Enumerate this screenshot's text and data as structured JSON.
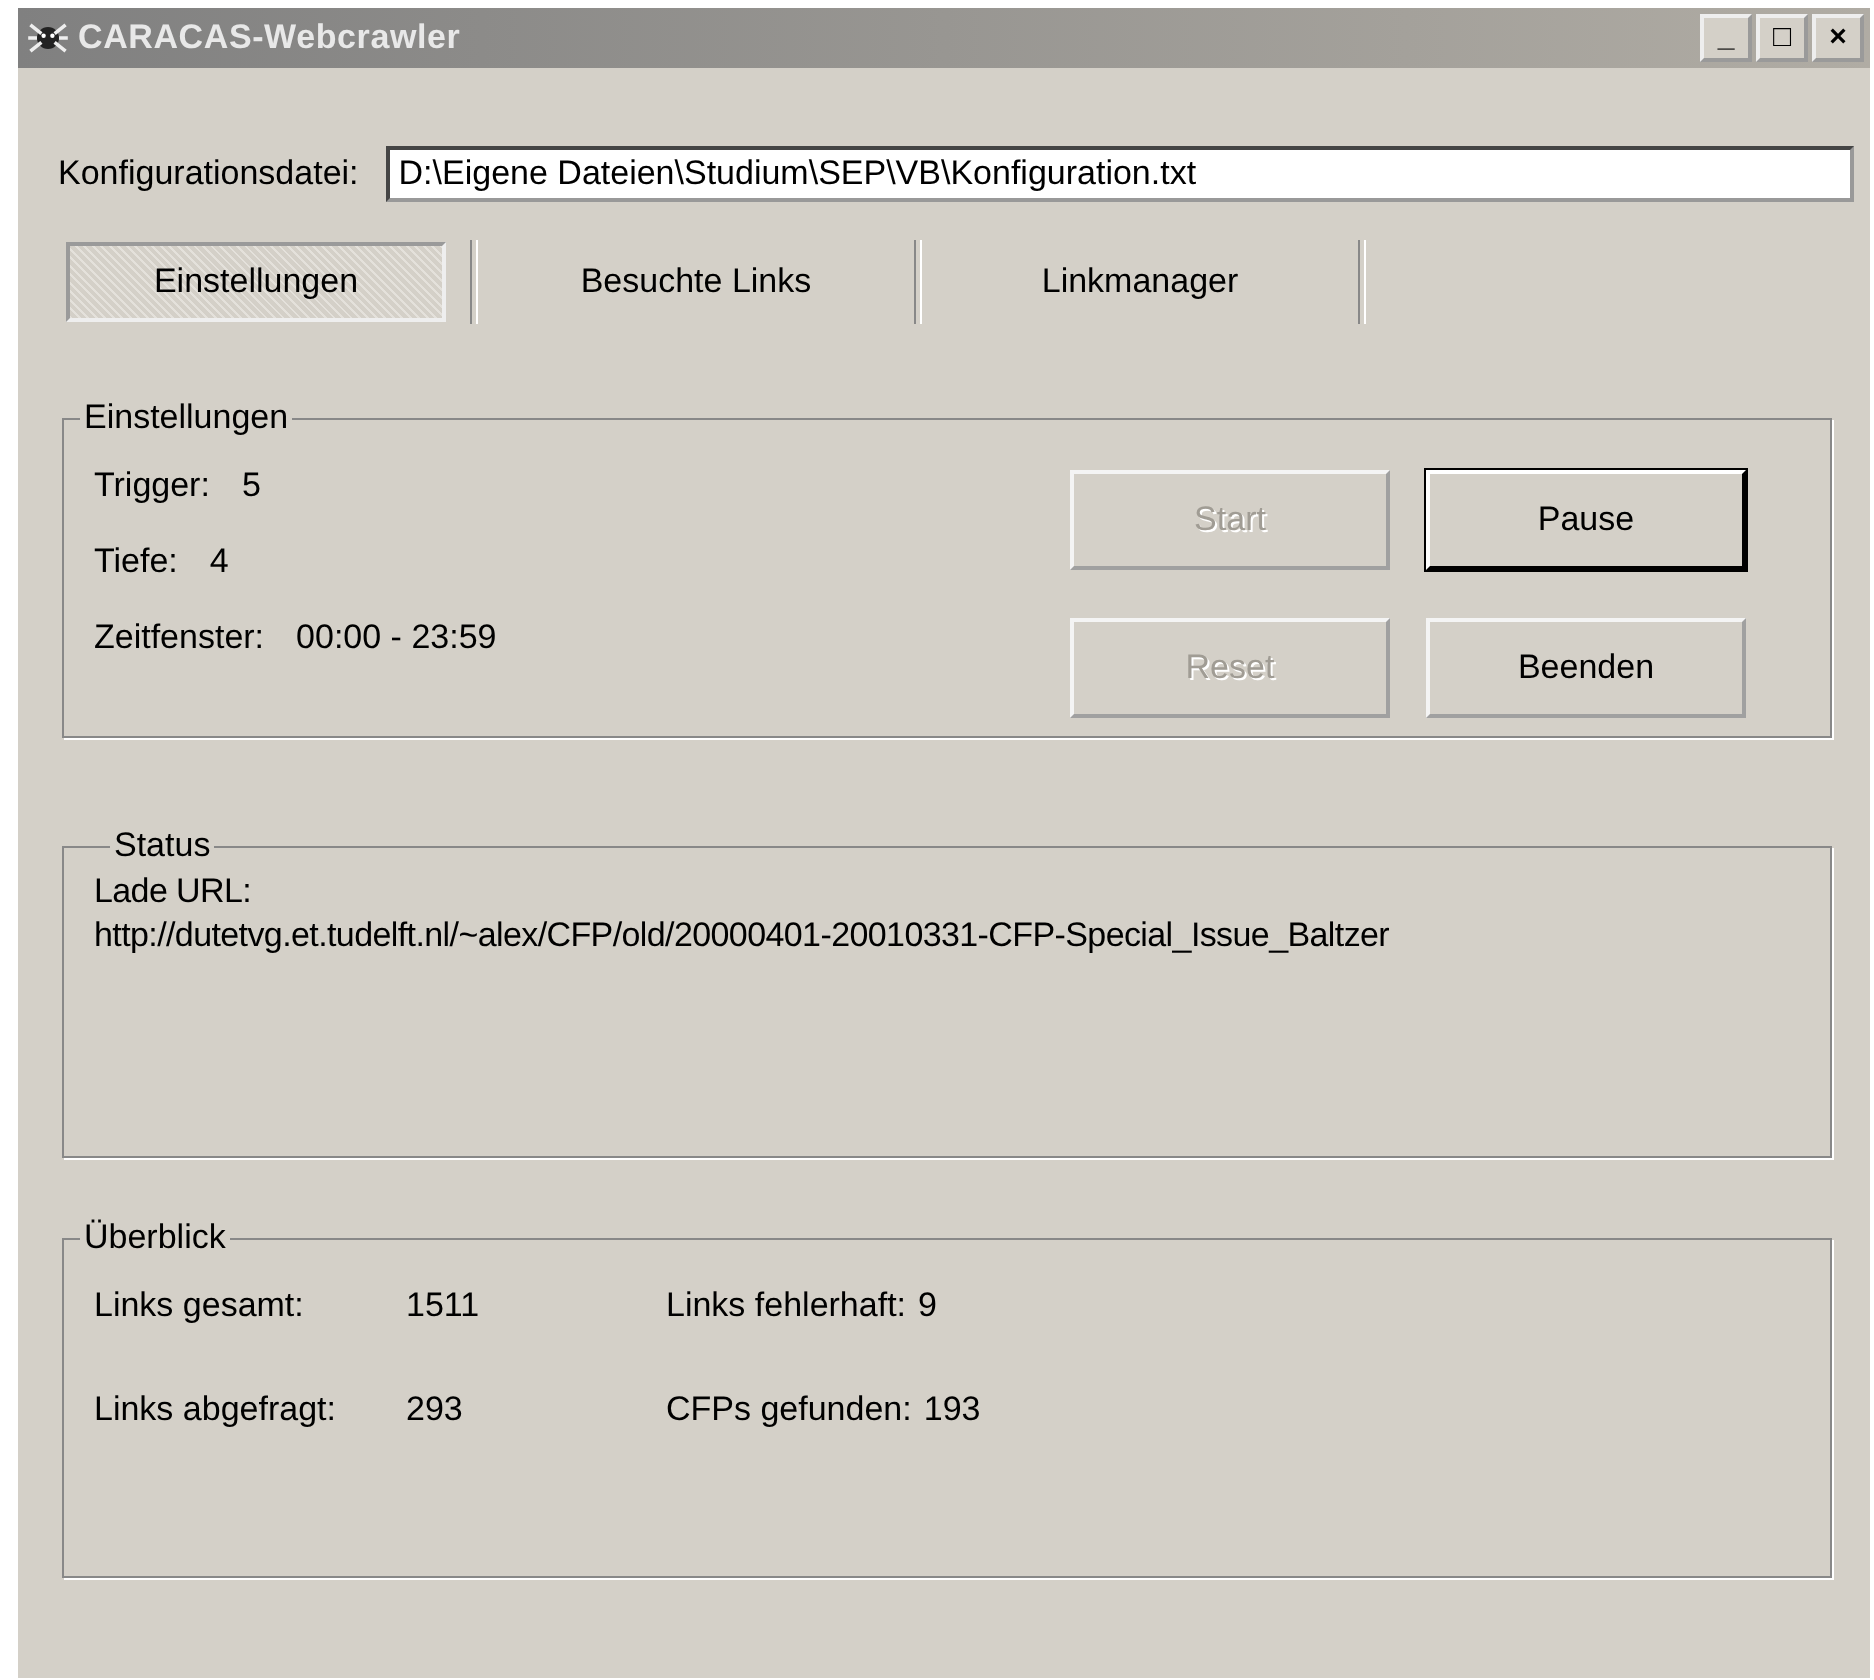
{
  "window": {
    "title": "CARACAS-Webcrawler",
    "controls": [
      "_",
      "□",
      "×"
    ]
  },
  "config": {
    "label": "Konfigurationsdatei:",
    "value": "D:\\Eigene Dateien\\Studium\\SEP\\VB\\Konfiguration.txt"
  },
  "tabs": [
    {
      "label": "Einstellungen",
      "selected": true
    },
    {
      "label": "Besuchte Links",
      "selected": false
    },
    {
      "label": "Linkmanager",
      "selected": false
    }
  ],
  "settings": {
    "title": "Einstellungen",
    "fields": [
      {
        "label": "Trigger:",
        "value": "5"
      },
      {
        "label": "Tiefe:",
        "value": "4"
      },
      {
        "label": "Zeitfenster:",
        "value": "00:00 - 23:59"
      }
    ],
    "buttons": [
      {
        "label": "Start",
        "disabled": true,
        "default": false
      },
      {
        "label": "Pause",
        "disabled": false,
        "default": true
      },
      {
        "label": "Reset",
        "disabled": true,
        "default": false
      },
      {
        "label": "Beenden",
        "disabled": false,
        "default": false
      }
    ]
  },
  "status": {
    "title": "Status",
    "lines": [
      "Lade URL:",
      "http://dutetvg.et.tudelft.nl/~alex/CFP/old/20000401-20010331-CFP-Special_Issue_Baltzer"
    ]
  },
  "overview": {
    "title": "Überblick",
    "stats": [
      {
        "label": "Links gesamt:",
        "value": "1511"
      },
      {
        "label": "Links fehlerhaft:",
        "value": "9"
      },
      {
        "label": "Links abgefragt:",
        "value": "293"
      },
      {
        "label": "CFPs gefunden:",
        "value": "193"
      }
    ]
  }
}
